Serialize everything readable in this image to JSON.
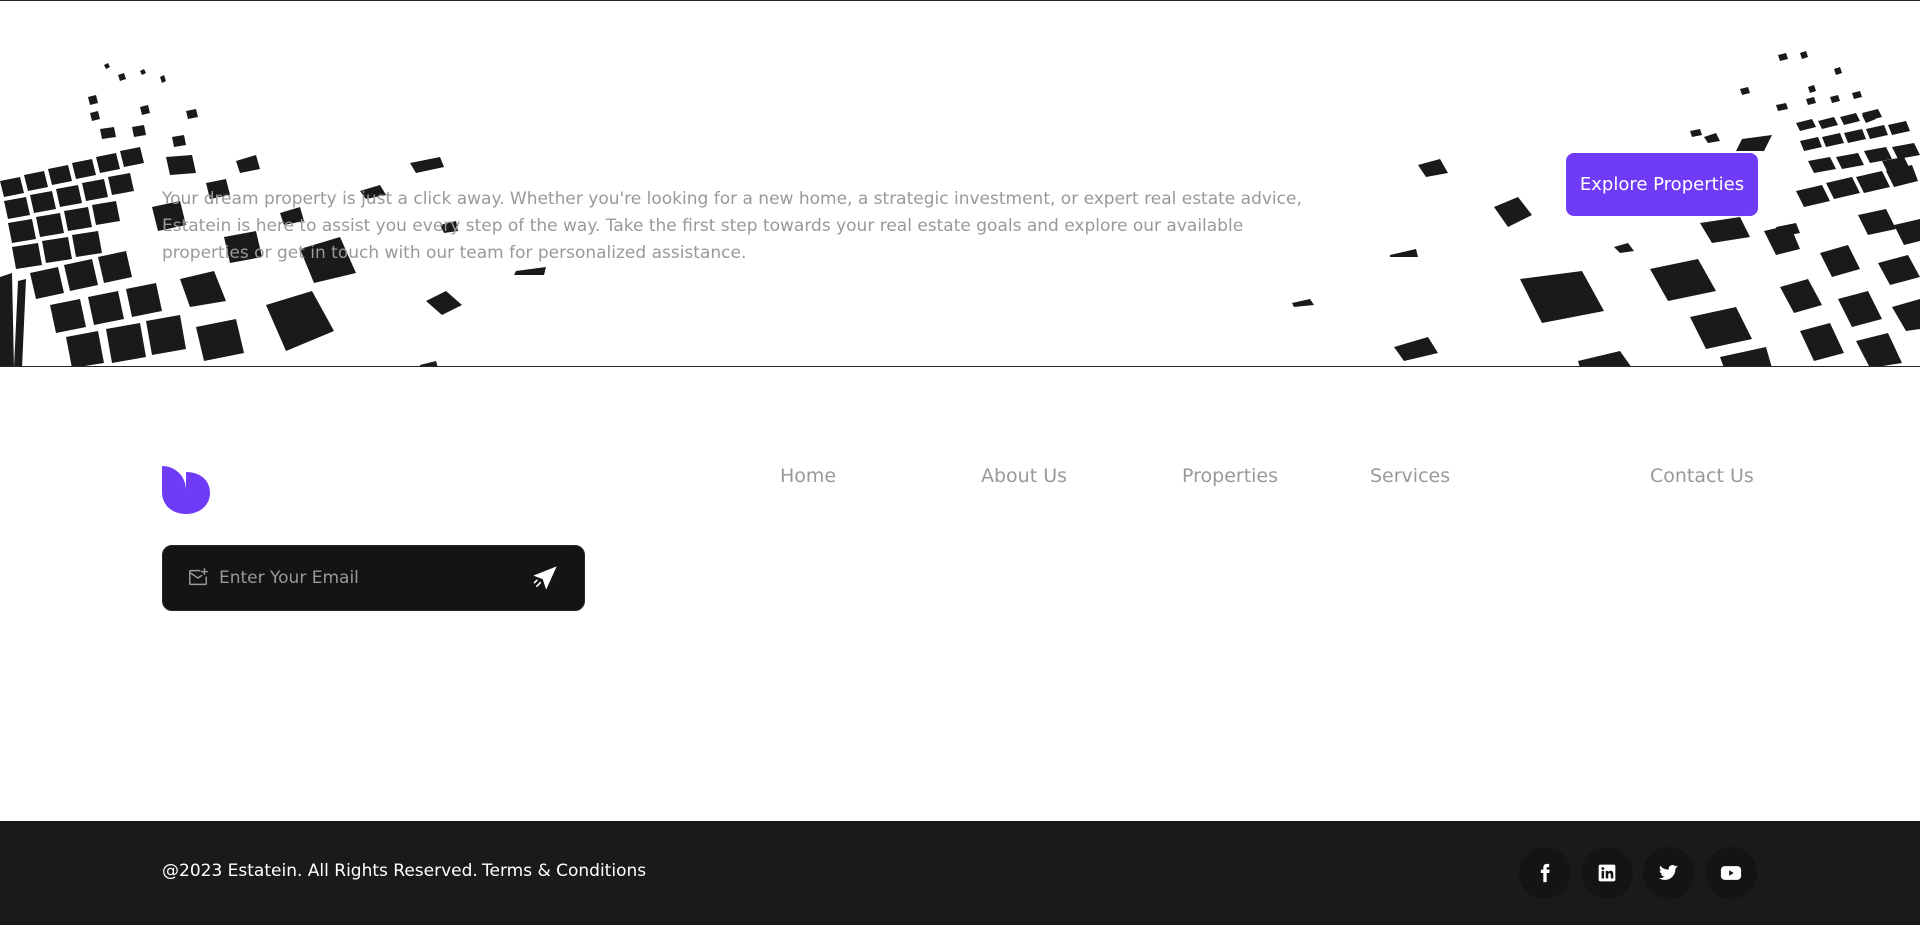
{
  "cta": {
    "description": "Your dream property is just a click away. Whether you're looking for a new home, a strategic investment, or expert real estate advice, Estatein is here to assist you every step of the way. Take the first step towards your real estate goals and explore our available properties or get in touch with our team for personalized assistance.",
    "button_label": "Explore Properties"
  },
  "footer": {
    "logo_icon": "estatein-logo-icon",
    "newsletter": {
      "icon": "mail-icon",
      "placeholder": "Enter Your Email",
      "value": "",
      "send_icon": "send-icon"
    },
    "nav": [
      {
        "label": "Home"
      },
      {
        "label": "About Us"
      },
      {
        "label": "Properties"
      },
      {
        "label": "Services"
      },
      {
        "label": "Contact Us"
      }
    ]
  },
  "bottom_bar": {
    "copyright": "@2023 Estatein. All Rights Reserved.",
    "terms": "Terms & Conditions",
    "socials": [
      "facebook-icon",
      "linkedin-icon",
      "twitter-icon",
      "youtube-icon"
    ]
  },
  "colors": {
    "accent": "#703BF7",
    "dark": "#1A1A1A",
    "muted_text": "#999999"
  }
}
